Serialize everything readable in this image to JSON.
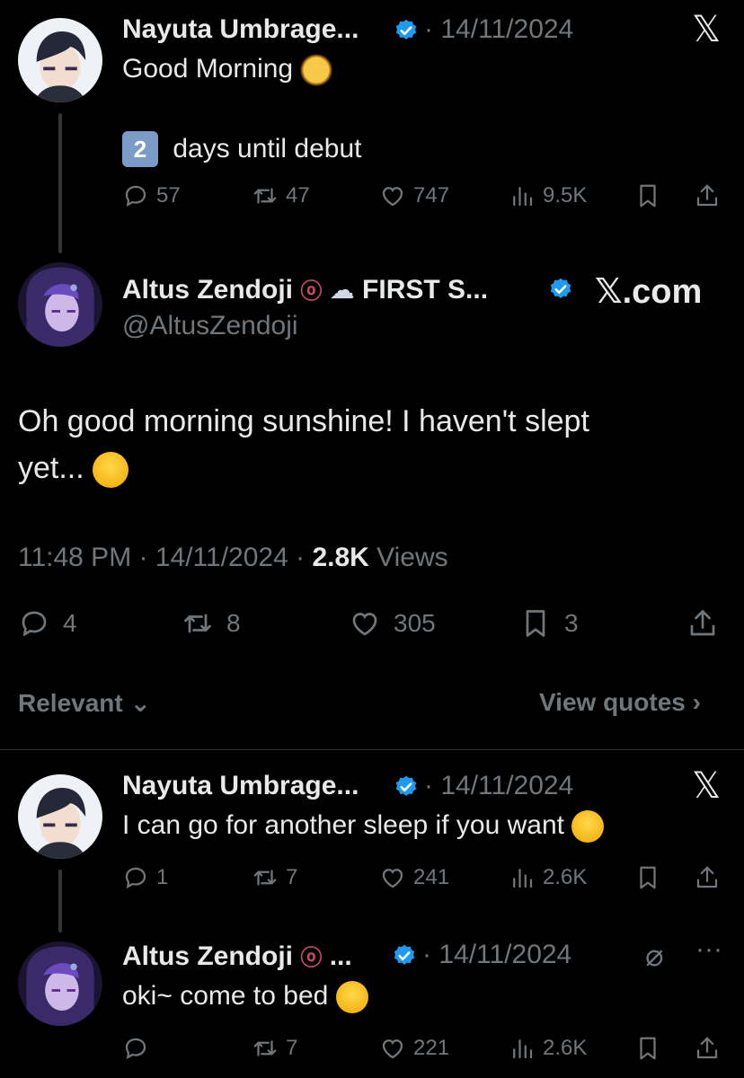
{
  "post1": {
    "author": "Nayuta Umbrage...",
    "date": "· 14/11/2024",
    "line1": "Good Morning",
    "line2_badge": "2",
    "line2": "days until debut",
    "replies": "57",
    "reposts": "47",
    "likes": "747",
    "views": "9.5K"
  },
  "main": {
    "author": "Altus Zendoji",
    "author_suffix": "FIRST S...",
    "handle": "@AltusZendoji",
    "brand": "𝕏.com",
    "text_line1": "Oh good morning sunshine! I haven't slept",
    "text_line2": "yet...",
    "time": "11:48 PM · 14/11/2024 ·",
    "views_count": "2.8K",
    "views_label": "Views",
    "replies": "4",
    "reposts": "8",
    "likes": "305",
    "bookmarks": "3"
  },
  "sort": {
    "relevant": "Relevant",
    "view_quotes": "View quotes"
  },
  "reply1": {
    "author": "Nayuta Umbrage...",
    "date": "· 14/11/2024",
    "text": "I can go for another sleep if you want",
    "replies": "1",
    "reposts": "7",
    "likes": "241",
    "views": "2.6K"
  },
  "reply2": {
    "author": "Altus Zendoji",
    "author_suffix": "...",
    "date": "· 14/11/2024",
    "text": "oki~ come to bed",
    "reposts": "7",
    "likes": "221",
    "views": "2.6K"
  },
  "colors": {
    "background": "#000000",
    "text": "#e7e9ea",
    "muted": "#71767b",
    "verified": "#1d9bf0",
    "divider": "#2f3336"
  }
}
